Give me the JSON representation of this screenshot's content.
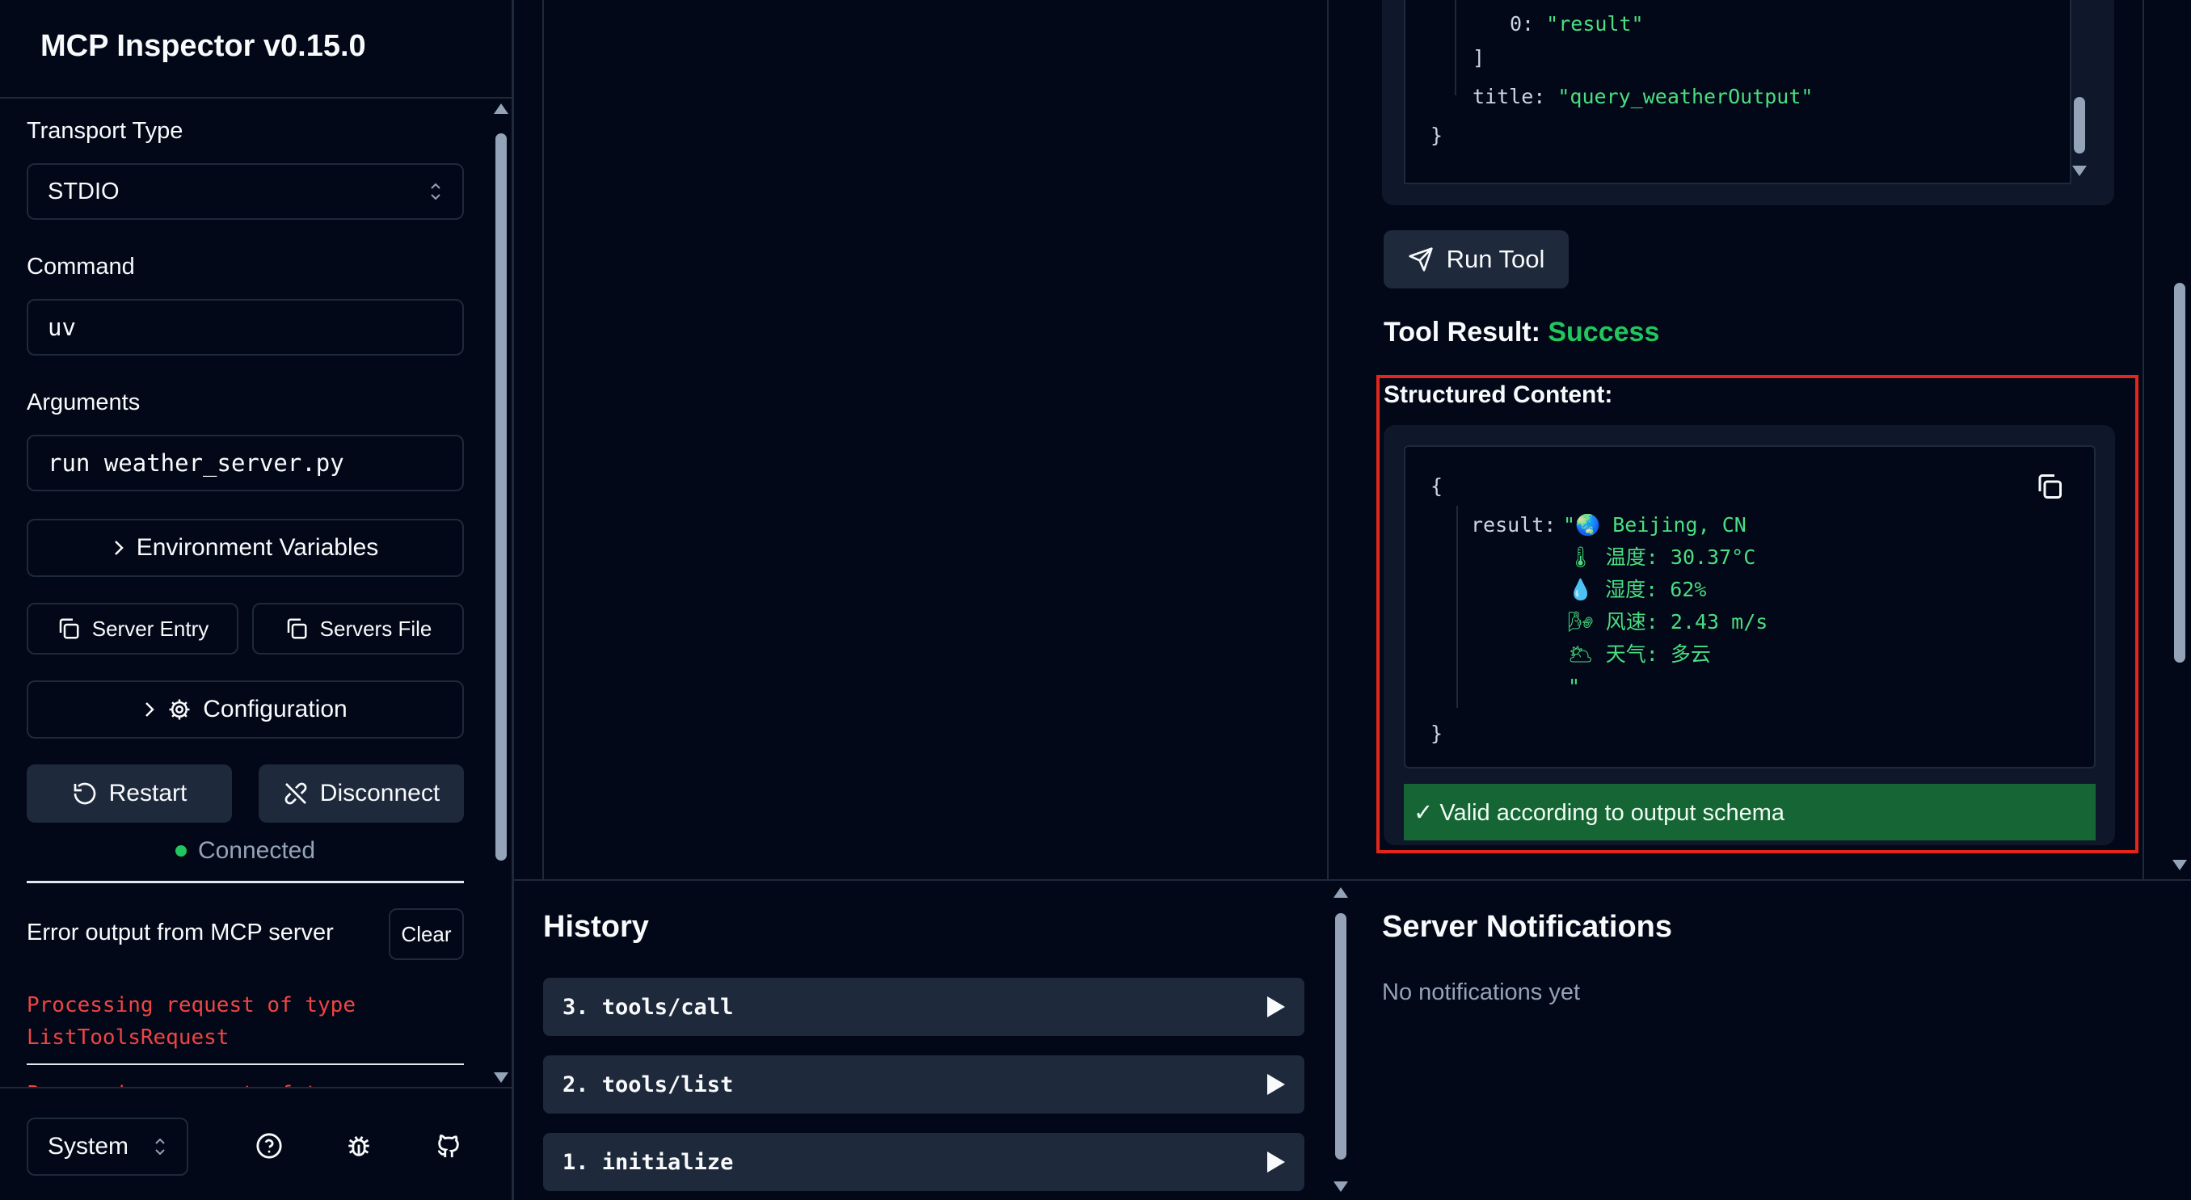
{
  "app": {
    "title": "MCP Inspector v0.15.0"
  },
  "connection": {
    "transport_label": "Transport Type",
    "transport_value": "STDIO",
    "command_label": "Command",
    "command_value": "uv",
    "arguments_label": "Arguments",
    "arguments_value": "run weather_server.py",
    "env_button": "Environment Variables",
    "server_entry_button": "Server Entry",
    "servers_file_button": "Servers File",
    "config_button": "Configuration",
    "restart_button": "Restart",
    "disconnect_button": "Disconnect",
    "status": "Connected",
    "status_color": "#22c55e"
  },
  "error_output": {
    "title": "Error output from MCP server",
    "clear_button": "Clear",
    "lines": [
      "Processing request of type",
      "ListToolsRequest",
      "Processing request of type"
    ],
    "color": "#ef4444"
  },
  "footer": {
    "theme_value": "System",
    "icons": [
      "help-icon",
      "bug-icon",
      "github-icon"
    ]
  },
  "schema_snippet": {
    "line1_key": "0:",
    "line1_value": "\"result\"",
    "line2": "]",
    "line3_key": "title:",
    "line3_value": "\"query_weatherOutput\"",
    "line4": "}"
  },
  "tool": {
    "run_button": "Run Tool",
    "result_label": "Tool Result:",
    "result_status": "Success",
    "structured_title": "Structured Content:",
    "open_brace": "{",
    "result_key": "result:",
    "result_lines": [
      "\"🌏 Beijing, CN",
      "🌡 温度: 30.37°C",
      "💧 湿度: 62%",
      "🌬 风速: 2.43 m/s",
      "🌥 天气: 多云",
      "\""
    ],
    "close_brace": "}",
    "valid_text": "✓ Valid according to output schema"
  },
  "history": {
    "title": "History",
    "items": [
      "3. tools/call",
      "2. tools/list",
      "1. initialize"
    ]
  },
  "notifications": {
    "title": "Server Notifications",
    "empty_text": "No notifications yet"
  }
}
